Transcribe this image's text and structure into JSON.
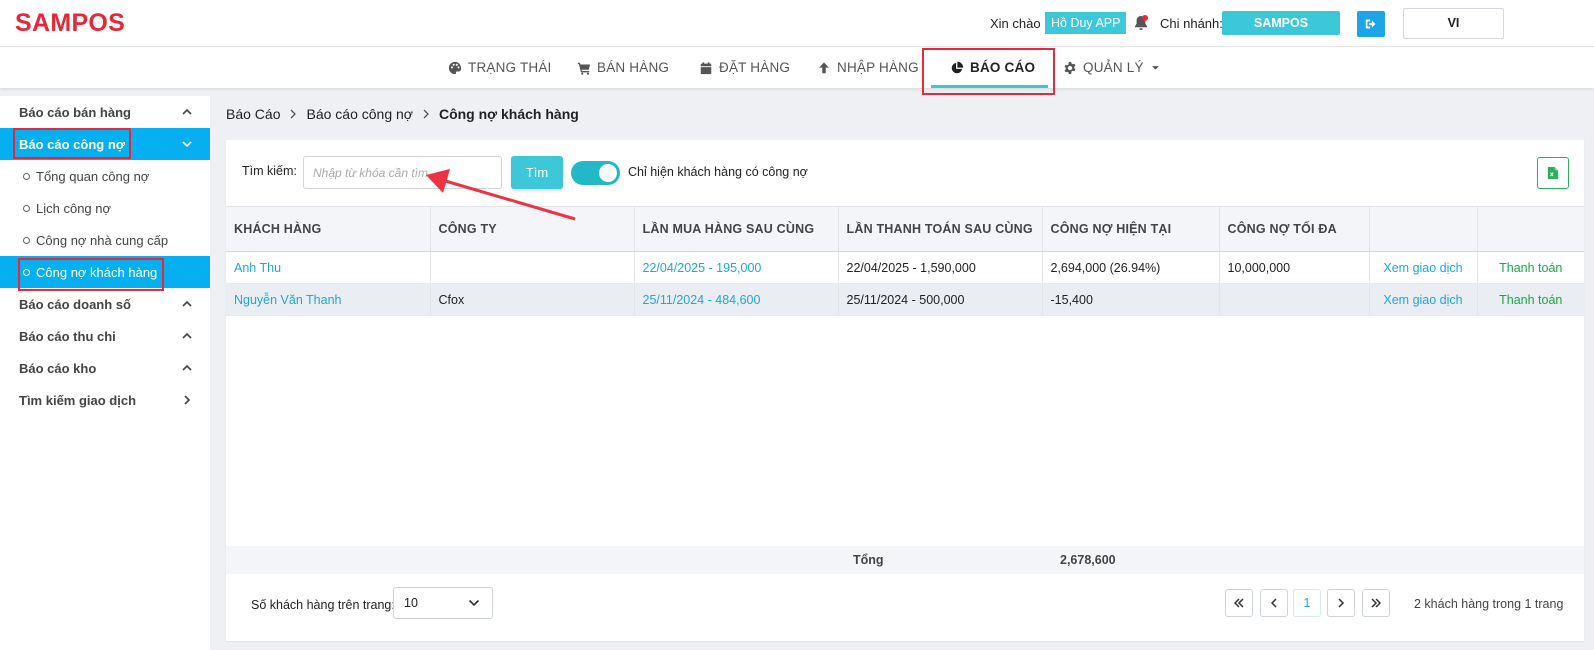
{
  "header": {
    "logo": "SAMPOS",
    "greeting": "Xin chào",
    "user_name": "Hồ Duy APP",
    "branch_label": "Chi nhánh:",
    "branch_name": "SAMPOS",
    "language": "VI"
  },
  "nav": {
    "items": [
      {
        "label": "TRẠNG THÁI",
        "icon": "palette-icon"
      },
      {
        "label": "BÁN HÀNG",
        "icon": "cart-icon"
      },
      {
        "label": "ĐẶT HÀNG",
        "icon": "calendar-icon"
      },
      {
        "label": "NHẬP HÀNG",
        "icon": "arrow-up-icon"
      },
      {
        "label": "BÁO CÁO",
        "icon": "pie-chart-icon",
        "active": true
      },
      {
        "label": "QUẢN LÝ",
        "icon": "gear-icon"
      }
    ]
  },
  "sidebar": {
    "groups": [
      {
        "label": "Báo cáo bán hàng"
      },
      {
        "label": "Báo cáo công nợ",
        "active": true
      },
      {
        "label": "Báo cáo doanh số"
      },
      {
        "label": "Báo cáo thu chi"
      },
      {
        "label": "Báo cáo kho"
      },
      {
        "label": "Tìm kiếm giao dịch"
      }
    ],
    "sub_items": [
      {
        "label": "Tổng quan công nợ"
      },
      {
        "label": "Lịch công nợ"
      },
      {
        "label": "Công nợ nhà cung cấp"
      },
      {
        "label": "Công nợ khách hàng",
        "active": true
      }
    ]
  },
  "breadcrumb": {
    "root": "Báo Cáo",
    "parent": "Báo cáo công nợ",
    "current": "Công nợ khách hàng"
  },
  "filters": {
    "search_label": "Tìm kiếm:",
    "search_placeholder": "Nhập từ khóa cần tìm",
    "search_button": "Tìm",
    "toggle_label": "Chỉ hiện khách hàng có công nợ",
    "toggle_on": true
  },
  "table": {
    "columns": [
      "KHÁCH HÀNG",
      "CÔNG TY",
      "LẦN MUA HÀNG SAU CÙNG",
      "LẦN THANH TOÁN SAU CÙNG",
      "CÔNG NỢ HIỆN TẠI",
      "CÔNG NỢ TỐI ĐA",
      "",
      ""
    ],
    "rows": [
      {
        "customer": "Anh Thu",
        "company": "",
        "last_purchase": "22/04/2025 - 195,000",
        "last_payment": "22/04/2025 - 1,590,000",
        "current_debt": "2,694,000 (26.94%)",
        "max_debt": "10,000,000",
        "view": "Xem giao dịch",
        "pay": "Thanh toán"
      },
      {
        "customer": "Nguyễn Văn Thanh",
        "company": "Cfox",
        "last_purchase": "25/11/2024 - 484,600",
        "last_payment": "25/11/2024 - 500,000",
        "current_debt": "-15,400",
        "max_debt": "",
        "view": "Xem giao dịch",
        "pay": "Thanh toán"
      }
    ],
    "total_label": "Tổng",
    "total_value": "2,678,600"
  },
  "pagination": {
    "page_size_label": "Số khách hàng trên trang:",
    "page_size": "10",
    "current_page": "1",
    "info": "2 khách hàng trong 1 trang"
  },
  "colors": {
    "brand": "#e8283a",
    "accent": "#3cc8d8",
    "sidebar_active": "#06b0f0",
    "link": "#1ea5e8",
    "pay_link": "#17a84a"
  }
}
